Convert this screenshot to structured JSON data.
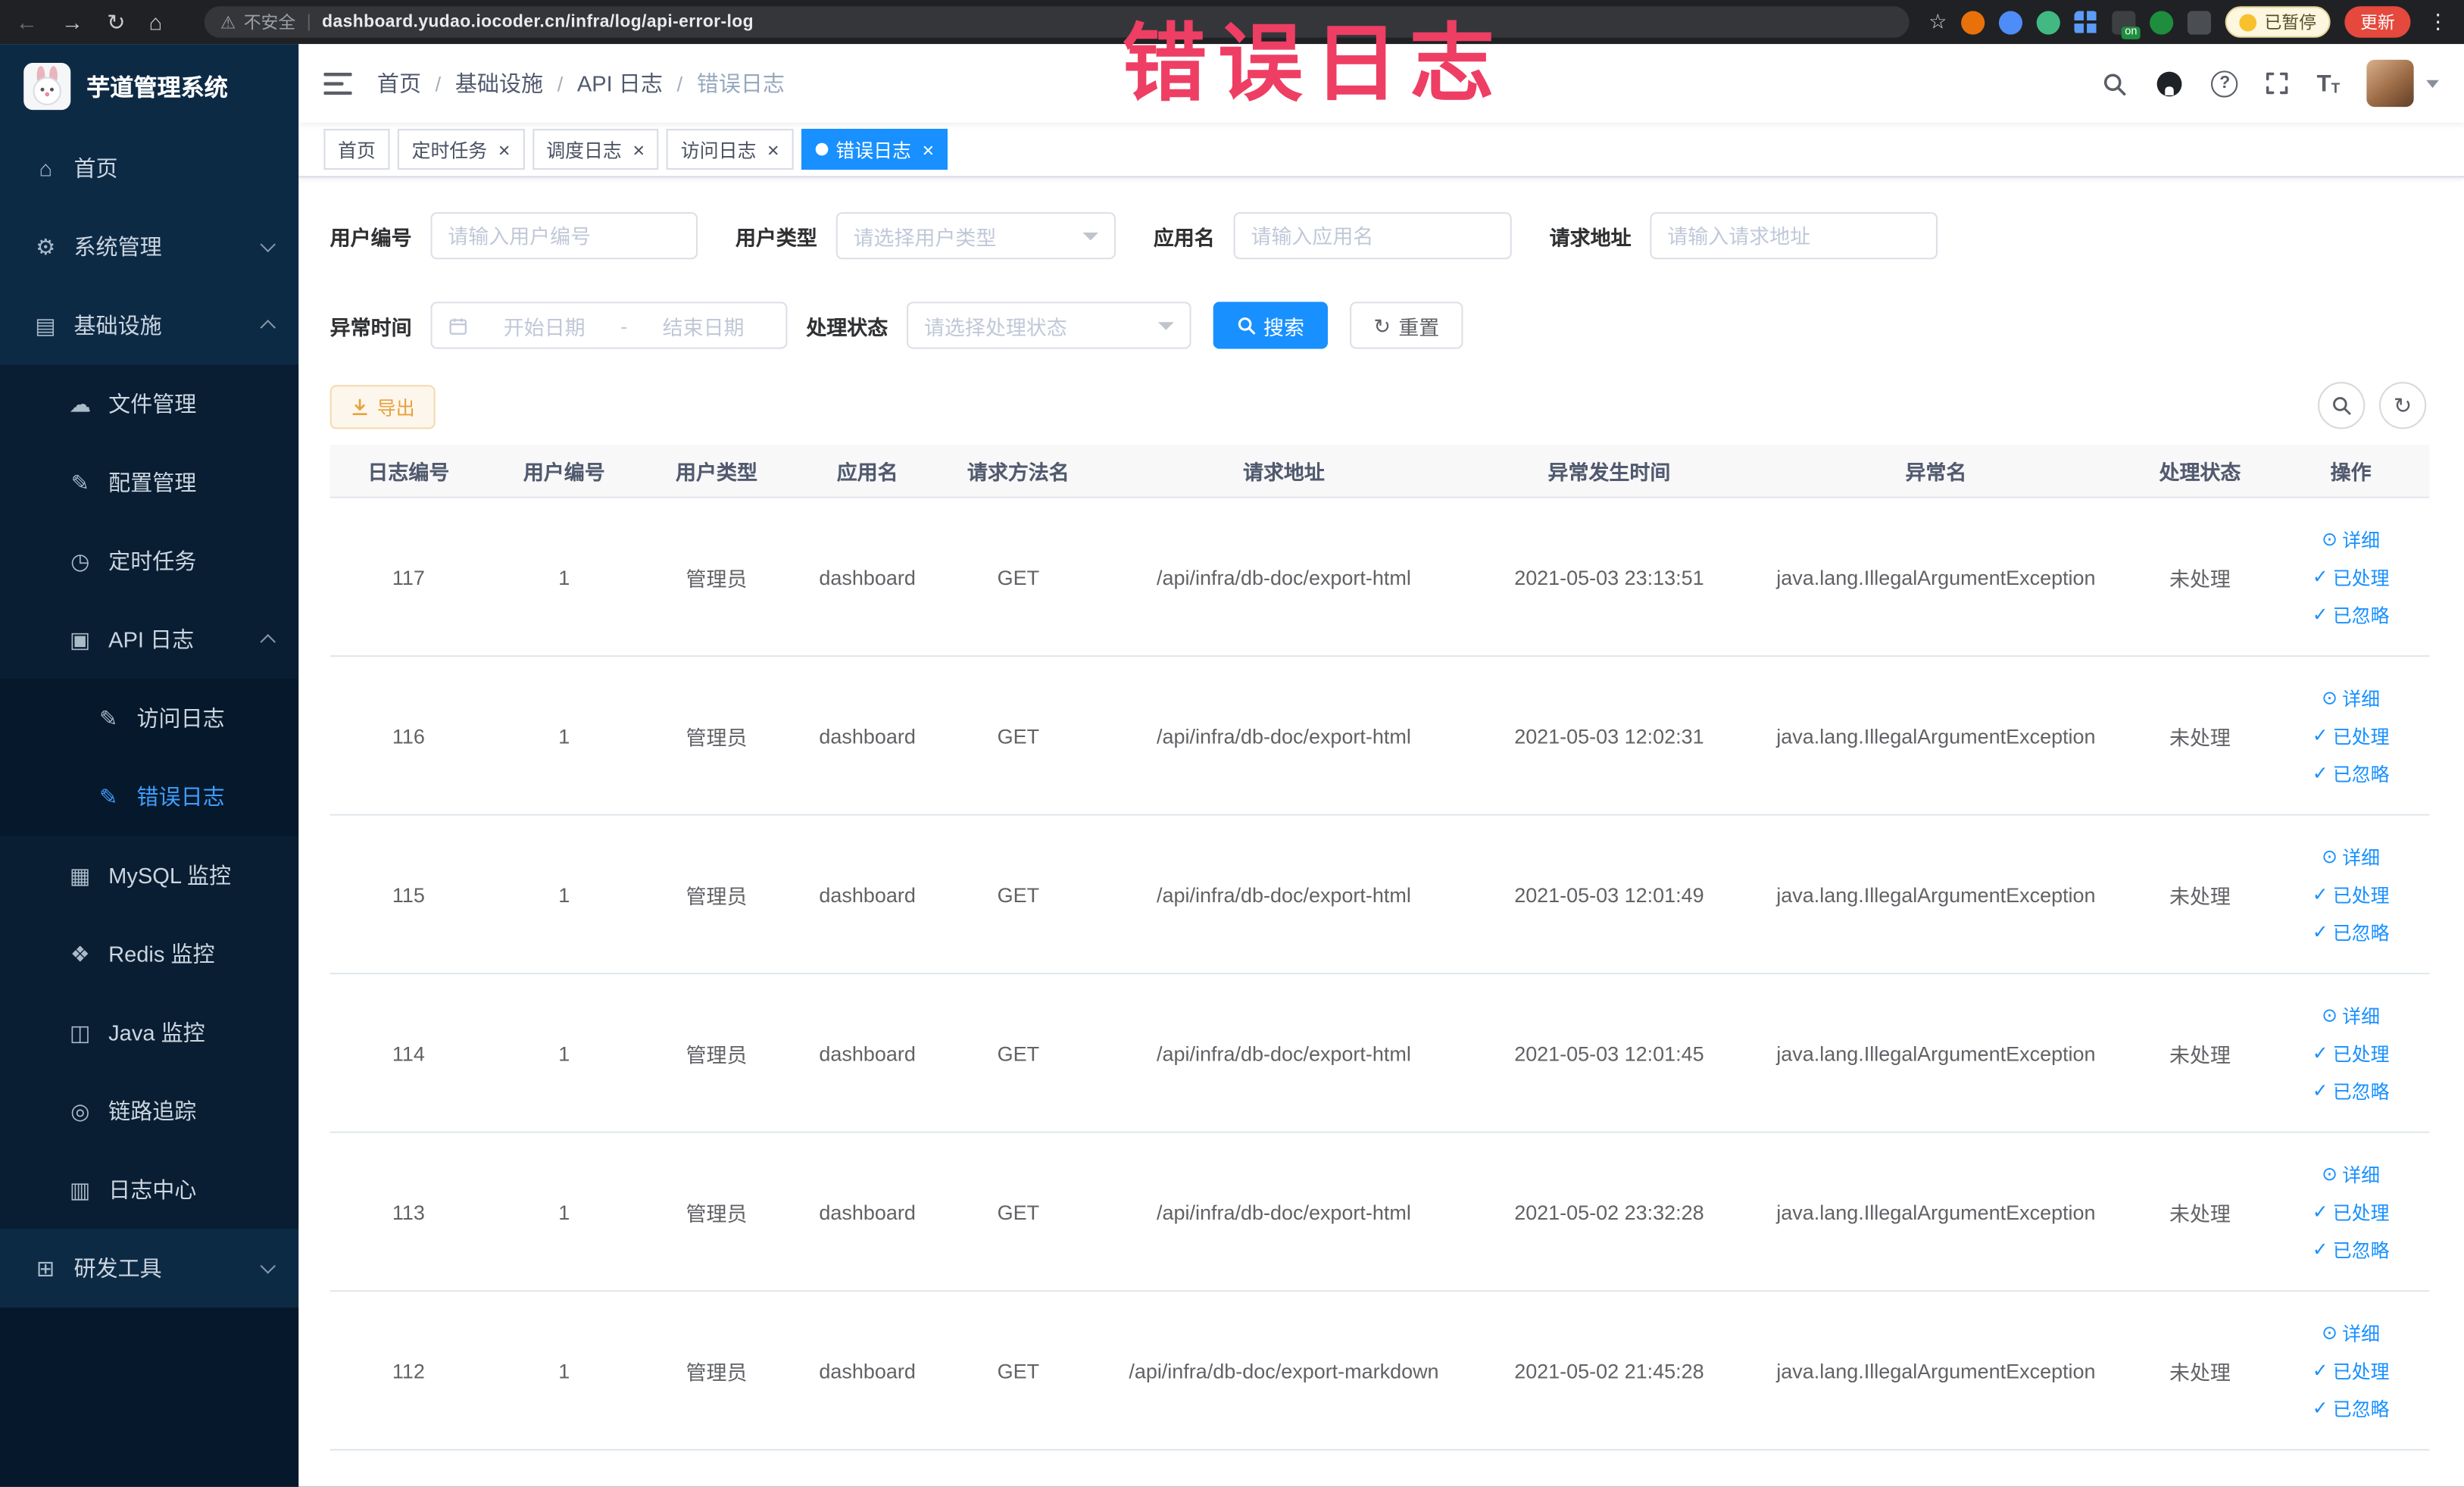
{
  "browser": {
    "security_label": "不安全",
    "url": "dashboard.yudao.iocoder.cn/infra/log/api-error-log",
    "extension_on_badge": "on",
    "paused_label": "已暂停",
    "update_label": "更新"
  },
  "overlay": {
    "text": "错误日志",
    "color": "#ee3e63"
  },
  "sidebar": {
    "title": "芋道管理系统",
    "items": [
      {
        "label": "首页",
        "icon": "home",
        "level": 1
      },
      {
        "label": "系统管理",
        "icon": "system-manage",
        "level": 1,
        "chevron": "down"
      },
      {
        "label": "基础设施",
        "icon": "infrastructure",
        "level": 1,
        "chevron": "up"
      },
      {
        "label": "文件管理",
        "icon": "file-manage",
        "level": 2
      },
      {
        "label": "配置管理",
        "icon": "config-manage",
        "level": 2
      },
      {
        "label": "定时任务",
        "icon": "scheduled-task",
        "level": 2
      },
      {
        "label": "API 日志",
        "icon": "api-log",
        "level": 2,
        "chevron": "up"
      },
      {
        "label": "访问日志",
        "icon": "access-log",
        "level": 3
      },
      {
        "label": "错误日志",
        "icon": "error-log",
        "level": 3,
        "active": true
      },
      {
        "label": "MySQL 监控",
        "icon": "mysql-monitor",
        "level": 2
      },
      {
        "label": "Redis 监控",
        "icon": "redis-monitor",
        "level": 2
      },
      {
        "label": "Java 监控",
        "icon": "java-monitor",
        "level": 2
      },
      {
        "label": "链路追踪",
        "icon": "trace",
        "level": 2
      },
      {
        "label": "日志中心",
        "icon": "log-center",
        "level": 2
      },
      {
        "label": "研发工具",
        "icon": "dev-tools",
        "level": 1,
        "chevron": "down"
      }
    ]
  },
  "breadcrumb": {
    "separator": "/",
    "items": [
      "首页",
      "基础设施",
      "API 日志",
      "错误日志"
    ]
  },
  "tabs": [
    {
      "label": "首页",
      "closable": false,
      "active": false
    },
    {
      "label": "定时任务",
      "closable": true,
      "active": false
    },
    {
      "label": "调度日志",
      "closable": true,
      "active": false
    },
    {
      "label": "访问日志",
      "closable": true,
      "active": false
    },
    {
      "label": "错误日志",
      "closable": true,
      "active": true
    }
  ],
  "filters": {
    "user_id": {
      "label": "用户编号",
      "placeholder": "请输入用户编号"
    },
    "user_type": {
      "label": "用户类型",
      "placeholder": "请选择用户类型"
    },
    "app_name": {
      "label": "应用名",
      "placeholder": "请输入应用名"
    },
    "request_url": {
      "label": "请求地址",
      "placeholder": "请输入请求地址"
    },
    "exception_time": {
      "label": "异常时间",
      "start_placeholder": "开始日期",
      "separator": "-",
      "end_placeholder": "结束日期"
    },
    "process_status": {
      "label": "处理状态",
      "placeholder": "请选择处理状态"
    },
    "search_label": "搜索",
    "reset_label": "重置"
  },
  "toolbar": {
    "export_label": "导出"
  },
  "table": {
    "columns": [
      "日志编号",
      "用户编号",
      "用户类型",
      "应用名",
      "请求方法名",
      "请求地址",
      "异常发生时间",
      "异常名",
      "处理状态",
      "操作"
    ],
    "actions": {
      "detail": "详细",
      "processed": "已处理",
      "ignored": "已忽略"
    },
    "rows": [
      [
        "117",
        "1",
        "管理员",
        "dashboard",
        "GET",
        "/api/infra/db-doc/export-html",
        "2021-05-03 23:13:51",
        "java.lang.IllegalArgumentException",
        "未处理"
      ],
      [
        "116",
        "1",
        "管理员",
        "dashboard",
        "GET",
        "/api/infra/db-doc/export-html",
        "2021-05-03 12:02:31",
        "java.lang.IllegalArgumentException",
        "未处理"
      ],
      [
        "115",
        "1",
        "管理员",
        "dashboard",
        "GET",
        "/api/infra/db-doc/export-html",
        "2021-05-03 12:01:49",
        "java.lang.IllegalArgumentException",
        "未处理"
      ],
      [
        "114",
        "1",
        "管理员",
        "dashboard",
        "GET",
        "/api/infra/db-doc/export-html",
        "2021-05-03 12:01:45",
        "java.lang.IllegalArgumentException",
        "未处理"
      ],
      [
        "113",
        "1",
        "管理员",
        "dashboard",
        "GET",
        "/api/infra/db-doc/export-html",
        "2021-05-02 23:32:28",
        "java.lang.IllegalArgumentException",
        "未处理"
      ],
      [
        "112",
        "1",
        "管理员",
        "dashboard",
        "GET",
        "/api/infra/db-doc/export-markdown",
        "2021-05-02 21:45:28",
        "java.lang.IllegalArgumentException",
        "未处理"
      ]
    ]
  }
}
